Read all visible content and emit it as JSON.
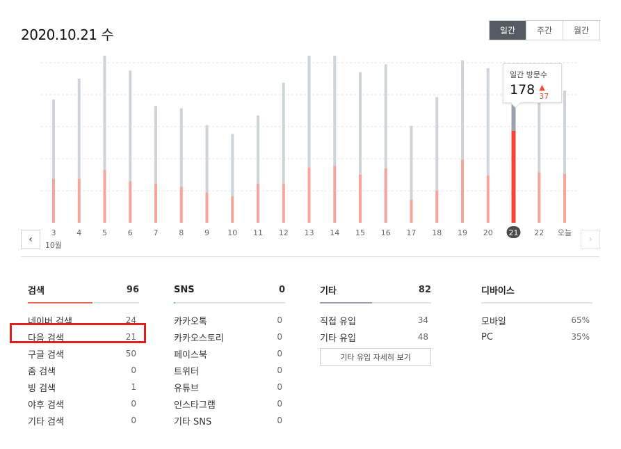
{
  "header": {
    "date": "2020.10.21 수"
  },
  "period_tabs": [
    "일간",
    "주간",
    "월간"
  ],
  "chart_data": {
    "type": "bar",
    "categories": [
      "3",
      "4",
      "5",
      "6",
      "7",
      "8",
      "9",
      "10",
      "11",
      "12",
      "13",
      "14",
      "15",
      "16",
      "17",
      "18",
      "19",
      "20",
      "21",
      "22",
      "오늘"
    ],
    "month_label": "10월",
    "selected": "21",
    "series": [
      {
        "values": [
          55,
          55,
          66,
          52,
          49,
          45,
          38,
          33,
          49,
          49,
          69,
          71,
          60,
          68,
          29,
          40,
          79,
          59,
          115,
          63,
          61
        ]
      },
      {
        "values": [
          99,
          125,
          144,
          138,
          97,
          98,
          84,
          78,
          85,
          126,
          156,
          176,
          128,
          130,
          92,
          117,
          124,
          134,
          63,
          113,
          104
        ]
      }
    ],
    "colors": {
      "bottom": "#f5a59c",
      "top": "#cfd4d8",
      "selected_bottom": "#f44336",
      "selected_top": "#9aa3ab",
      "divider": "#5dc9be"
    },
    "ylim": [
      0,
      200
    ],
    "grid": true,
    "tooltip": {
      "label": "일간 방문수",
      "value": "178",
      "delta": "37"
    }
  },
  "nav": {
    "prev_icon": "‹",
    "next_icon": "›"
  },
  "stats": {
    "search": {
      "title": "검색",
      "total": "96",
      "bar_color": "#f06e58",
      "bar_fill": 0.58,
      "rows": [
        {
          "label": "네이버 검색",
          "value": "24"
        },
        {
          "label": "다음 검색",
          "value": "21"
        },
        {
          "label": "구글 검색",
          "value": "50"
        },
        {
          "label": "줌 검색",
          "value": "0"
        },
        {
          "label": "빙 검색",
          "value": "1"
        },
        {
          "label": "야후 검색",
          "value": "0"
        },
        {
          "label": "기타 검색",
          "value": "0"
        }
      ]
    },
    "sns": {
      "title": "SNS",
      "total": "0",
      "bar_color": "#5dc9be",
      "bar_fill": 0.01,
      "rows": [
        {
          "label": "카카오톡",
          "value": "0"
        },
        {
          "label": "카카오스토리",
          "value": "0"
        },
        {
          "label": "페이스북",
          "value": "0"
        },
        {
          "label": "트위터",
          "value": "0"
        },
        {
          "label": "유튜브",
          "value": "0"
        },
        {
          "label": "인스타그램",
          "value": "0"
        },
        {
          "label": "기타 SNS",
          "value": "0"
        }
      ]
    },
    "etc": {
      "title": "기타",
      "total": "82",
      "bar_color": "#9aa3ab",
      "bar_fill": 0.47,
      "rows": [
        {
          "label": "직접 유입",
          "value": "34"
        },
        {
          "label": "기타 유입",
          "value": "48"
        }
      ],
      "detail_button": "기타 유입 자세히 보기"
    },
    "device": {
      "title": "디바이스",
      "rows": [
        {
          "label": "모바일",
          "value": "65%"
        },
        {
          "label": "PC",
          "value": "35%"
        }
      ]
    }
  }
}
